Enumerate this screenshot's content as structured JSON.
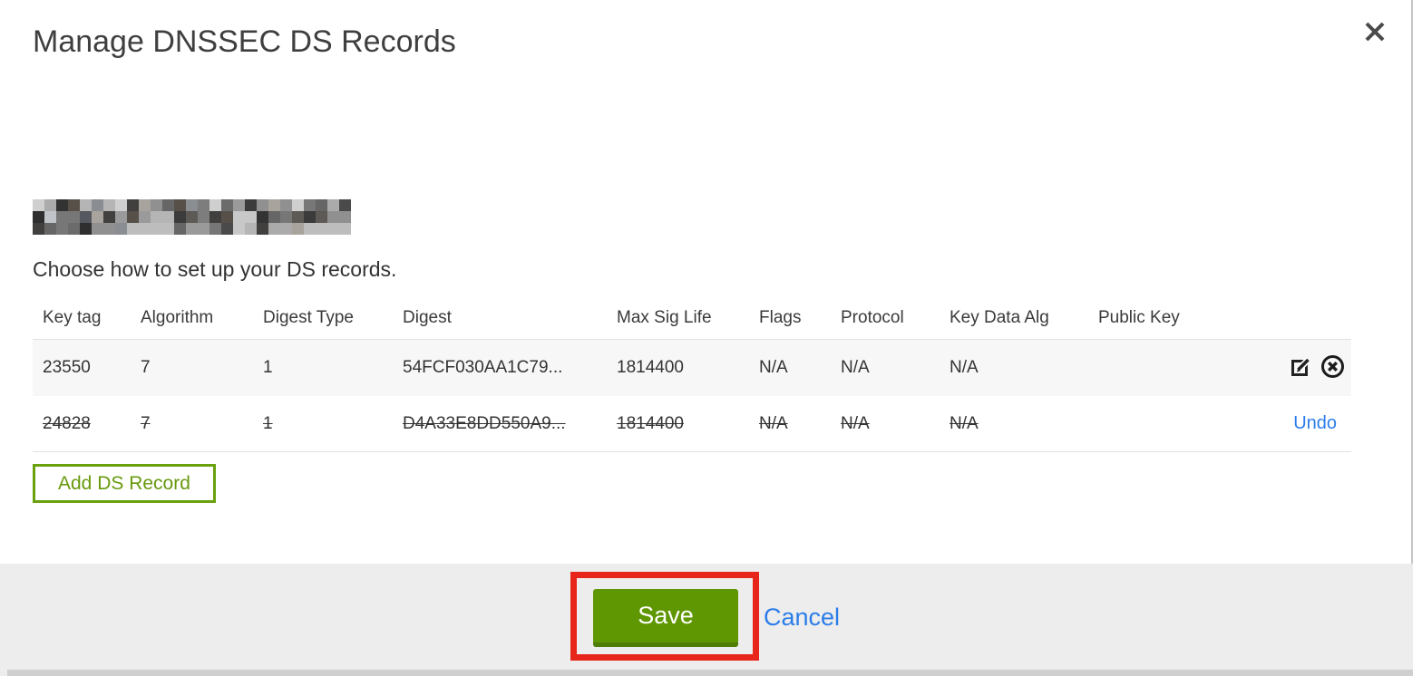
{
  "modal": {
    "title": "Manage DNSSEC DS Records",
    "domain": {
      "redacted": true
    },
    "instruction": "Choose how to set up your DS records.",
    "table": {
      "columns": [
        "Key tag",
        "Algorithm",
        "Digest Type",
        "Digest",
        "Max Sig Life",
        "Flags",
        "Protocol",
        "Key Data Alg",
        "Public Key"
      ],
      "rows": [
        {
          "cells": [
            "23550",
            "7",
            "1",
            "54FCF030AA1C79...",
            "1814400",
            "N/A",
            "N/A",
            "N/A",
            ""
          ],
          "deleted": false,
          "actions": [
            "edit",
            "delete"
          ]
        },
        {
          "cells": [
            "24828",
            "7",
            "1",
            "D4A33E8DD550A9...",
            "1814400",
            "N/A",
            "N/A",
            "N/A",
            ""
          ],
          "deleted": true,
          "undo_label": "Undo"
        }
      ]
    },
    "add_button_label": "Add DS Record",
    "footer": {
      "save_label": "Save",
      "cancel_label": "Cancel"
    }
  },
  "icons": {
    "close": "x-icon",
    "edit": "edit-pencil-square-icon",
    "delete": "circle-x-icon"
  },
  "colors": {
    "save_green": "#5f9702",
    "save_green_shade": "#4e7d03",
    "add_border_green": "#6aa10e",
    "link_blue": "#2b7de9",
    "annotation_red": "#e8251a",
    "footer_gray": "#ededed",
    "row_stripe": "#f7f7f7",
    "title_gray": "#3f3f3f"
  }
}
